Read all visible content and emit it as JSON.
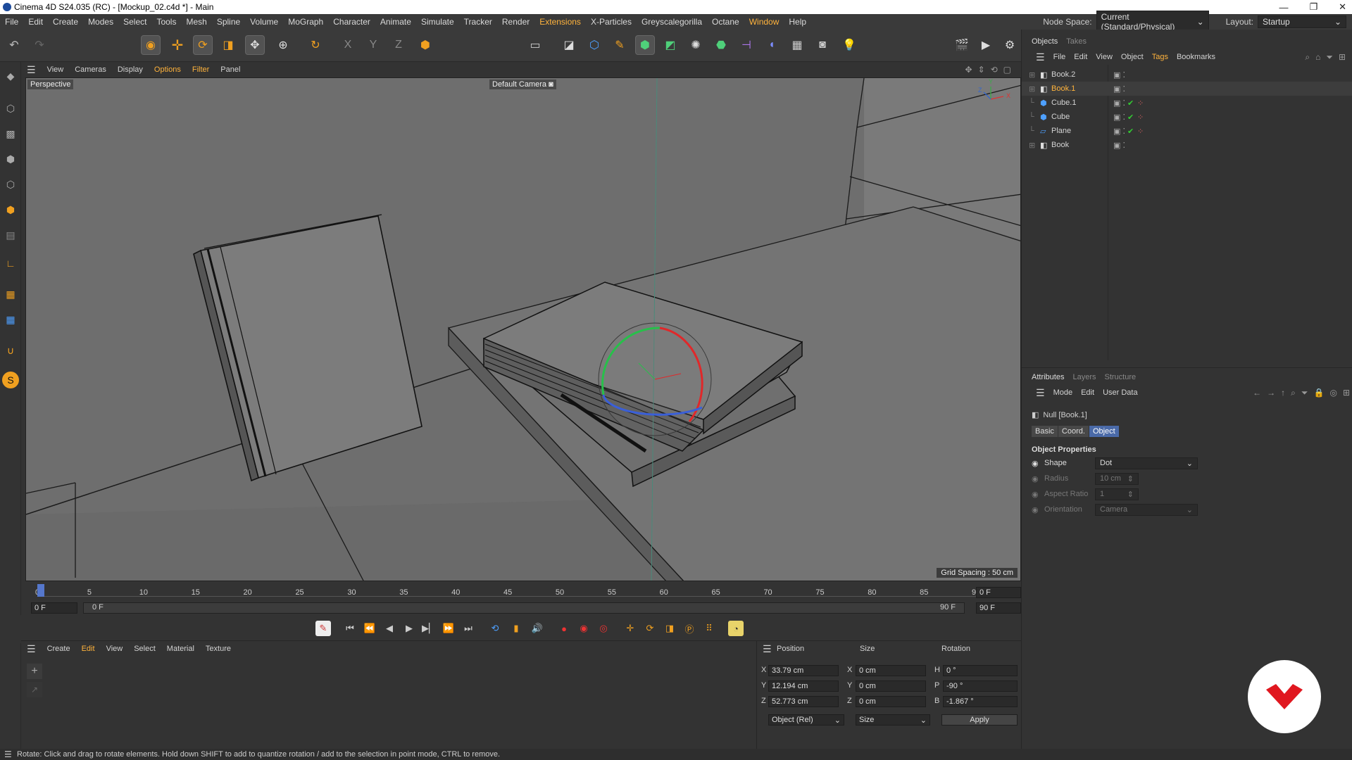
{
  "window": {
    "title": "Cinema 4D S24.035 (RC) - [Mockup_02.c4d *] - Main",
    "controls": [
      "—",
      "❐",
      "✕"
    ]
  },
  "menubar": {
    "items": [
      "File",
      "Edit",
      "Create",
      "Modes",
      "Select",
      "Tools",
      "Mesh",
      "Spline",
      "Volume",
      "MoGraph",
      "Character",
      "Animate",
      "Simulate",
      "Tracker",
      "Render",
      "Extensions",
      "X-Particles",
      "Greyscalegorilla",
      "Octane",
      "Window",
      "Help"
    ],
    "node_space_label": "Node Space:",
    "node_space_value": "Current (Standard/Physical)",
    "layout_label": "Layout:",
    "layout_value": "Startup"
  },
  "viewport": {
    "menu": [
      "View",
      "Cameras",
      "Display",
      "Options",
      "Filter",
      "Panel"
    ],
    "label": "Perspective",
    "camera": "Default Camera",
    "camera_icon": "camera-icon",
    "grid_spacing": "Grid Spacing : 50 cm",
    "axis_labels": [
      "Y",
      "X",
      "Z"
    ]
  },
  "timeline": {
    "ticks": [
      "0",
      "5",
      "10",
      "15",
      "20",
      "25",
      "30",
      "35",
      "40",
      "45",
      "50",
      "55",
      "60",
      "65",
      "70",
      "75",
      "80",
      "85",
      "90"
    ],
    "current_frame": "0 F",
    "start_frame": "0 F",
    "range_start": "0 F",
    "range_end": "90 F",
    "end_frame": "90 F"
  },
  "material_manager": {
    "menu": [
      "Create",
      "Edit",
      "View",
      "Select",
      "Material",
      "Texture"
    ]
  },
  "coordinates": {
    "headers": [
      "Position",
      "Size",
      "Rotation"
    ],
    "rows": [
      {
        "axis": "X",
        "pos": "33.79 cm",
        "size_axis": "X",
        "size": "0 cm",
        "rot_axis": "H",
        "rot": "0 °"
      },
      {
        "axis": "Y",
        "pos": "12.194 cm",
        "size_axis": "Y",
        "size": "0 cm",
        "rot_axis": "P",
        "rot": "-90 °"
      },
      {
        "axis": "Z",
        "pos": "52.773 cm",
        "size_axis": "Z",
        "size": "0 cm",
        "rot_axis": "B",
        "rot": "-1.867 °"
      }
    ],
    "mode": "Object (Rel)",
    "size_mode": "Size",
    "apply": "Apply"
  },
  "objects_panel": {
    "tabs": [
      "Objects",
      "Takes"
    ],
    "menu": [
      "File",
      "Edit",
      "View",
      "Object",
      "Tags",
      "Bookmarks"
    ],
    "items": [
      {
        "name": "Book.2",
        "type": "null",
        "selected": false,
        "tags": false
      },
      {
        "name": "Book.1",
        "type": "null",
        "selected": true,
        "tags": false
      },
      {
        "name": "Cube.1",
        "type": "cube",
        "selected": false,
        "tags": true
      },
      {
        "name": "Cube",
        "type": "cube",
        "selected": false,
        "tags": true
      },
      {
        "name": "Plane",
        "type": "plane",
        "selected": false,
        "tags": true
      },
      {
        "name": "Book",
        "type": "null",
        "selected": false,
        "tags": false
      }
    ]
  },
  "attributes_panel": {
    "tabs": [
      "Attributes",
      "Layers",
      "Structure"
    ],
    "menu": [
      "Mode",
      "Edit",
      "User Data"
    ],
    "object_name": "Null [Book.1]",
    "subtabs": [
      "Basic",
      "Coord.",
      "Object"
    ],
    "section": "Object Properties",
    "props": [
      {
        "label": "Shape",
        "value": "Dot",
        "enabled": true
      },
      {
        "label": "Radius",
        "value": "10 cm",
        "enabled": false
      },
      {
        "label": "Aspect Ratio",
        "value": "1",
        "enabled": false
      },
      {
        "label": "Orientation",
        "value": "Camera",
        "enabled": false
      }
    ]
  },
  "statusbar": {
    "text": "Rotate: Click and drag to rotate elements. Hold down SHIFT to add to quantize rotation / add to the selection in point mode, CTRL to remove."
  },
  "colors": {
    "accent": "#ffb33c",
    "selection_blue": "#4a6aa8",
    "logo_red": "#e0171f"
  }
}
